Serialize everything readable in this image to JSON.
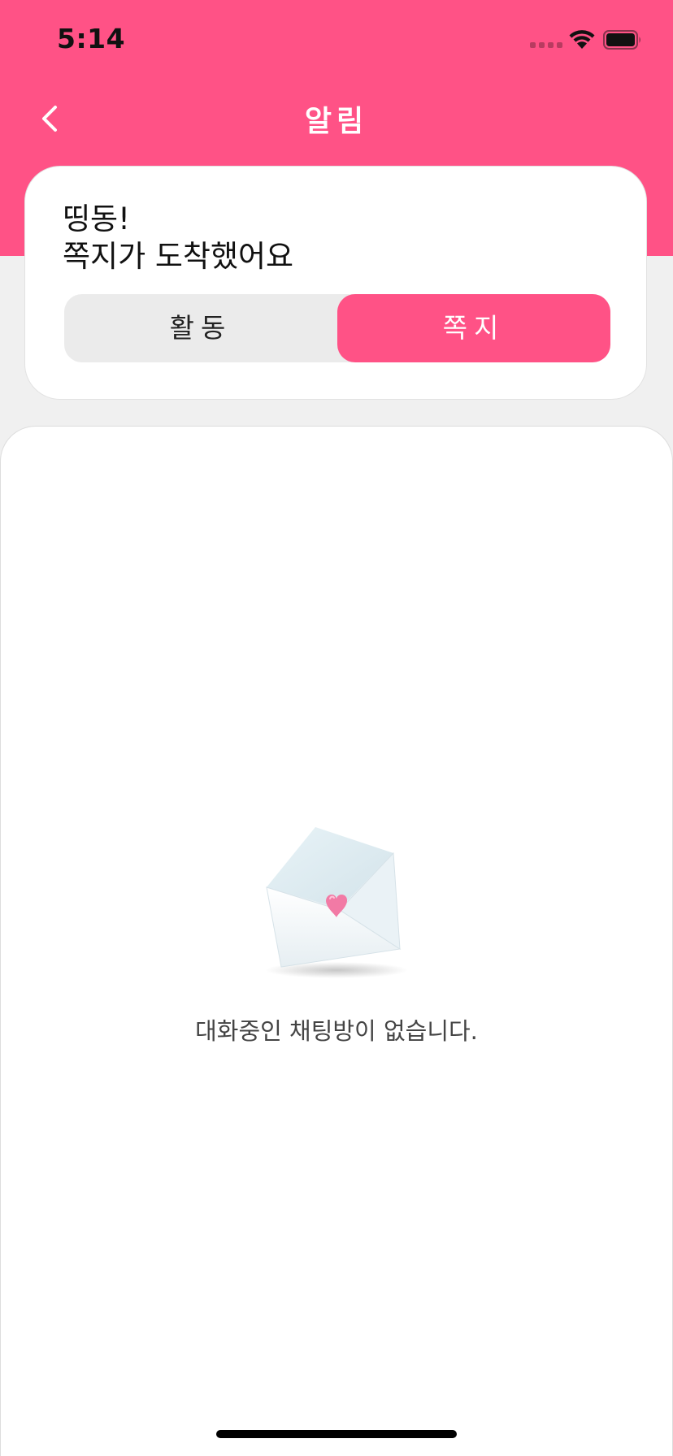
{
  "status_bar": {
    "time": "5:14"
  },
  "header": {
    "title": "알림",
    "background_color": "#ff5286"
  },
  "top_card": {
    "title_line1": "띵동!",
    "title_line2": "쪽지가 도착했어요"
  },
  "tabs": {
    "activity_label": "활동",
    "message_label": "쪽지",
    "selected": "쪽지",
    "selected_color": "#ff5286"
  },
  "empty_state": {
    "icon": "envelope-heart-icon",
    "message": "대화중인 채팅방이 없습니다."
  }
}
